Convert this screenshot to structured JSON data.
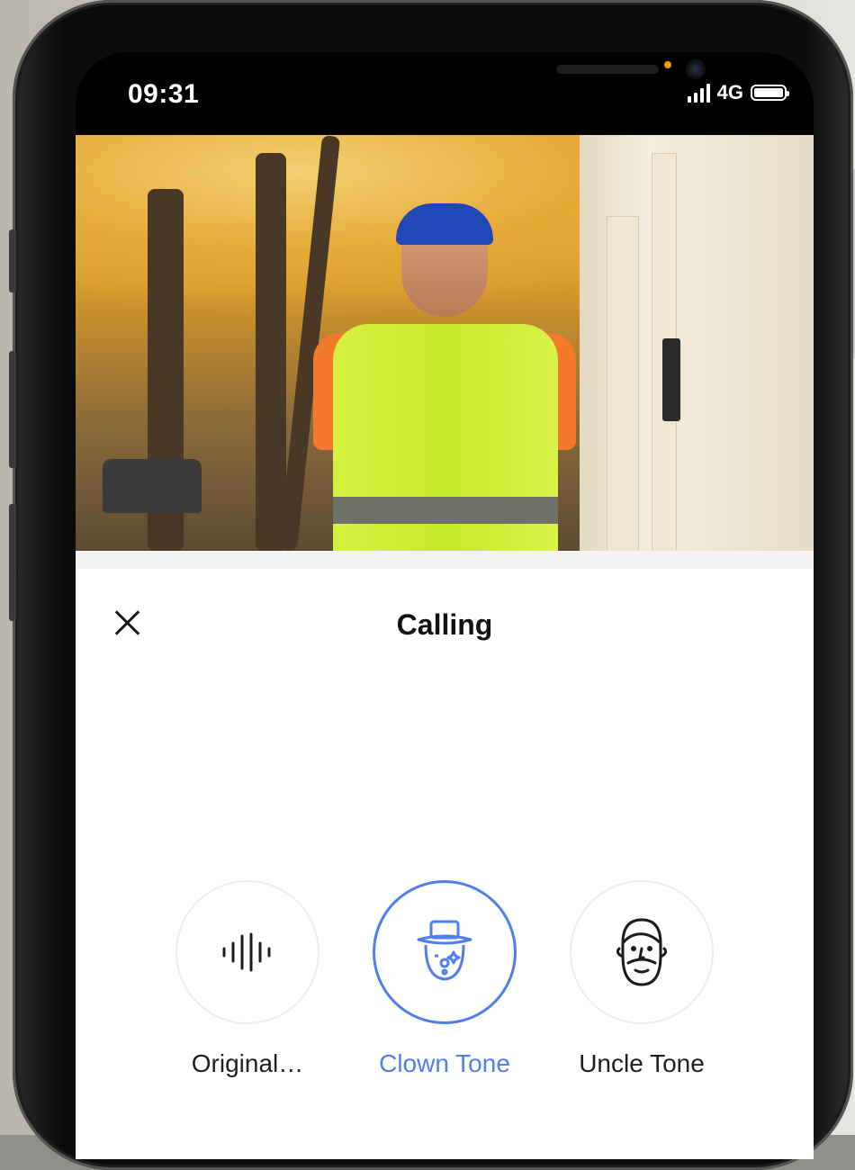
{
  "status_bar": {
    "time": "09:31",
    "network": "4G"
  },
  "video": {
    "description_icon": "doorbell-camera-feed"
  },
  "call_sheet": {
    "title": "Calling",
    "close_icon": "close-icon"
  },
  "voice_tones": [
    {
      "label": "Original…",
      "icon": "waveform-icon",
      "selected": false
    },
    {
      "label": "Clown Tone",
      "icon": "clown-face-icon",
      "selected": true
    },
    {
      "label": "Uncle Tone",
      "icon": "bearded-face-icon",
      "selected": false
    }
  ],
  "colors": {
    "accent": "#4f7ef0",
    "text": "#121212",
    "indicator_dot": "#f59e0b"
  }
}
